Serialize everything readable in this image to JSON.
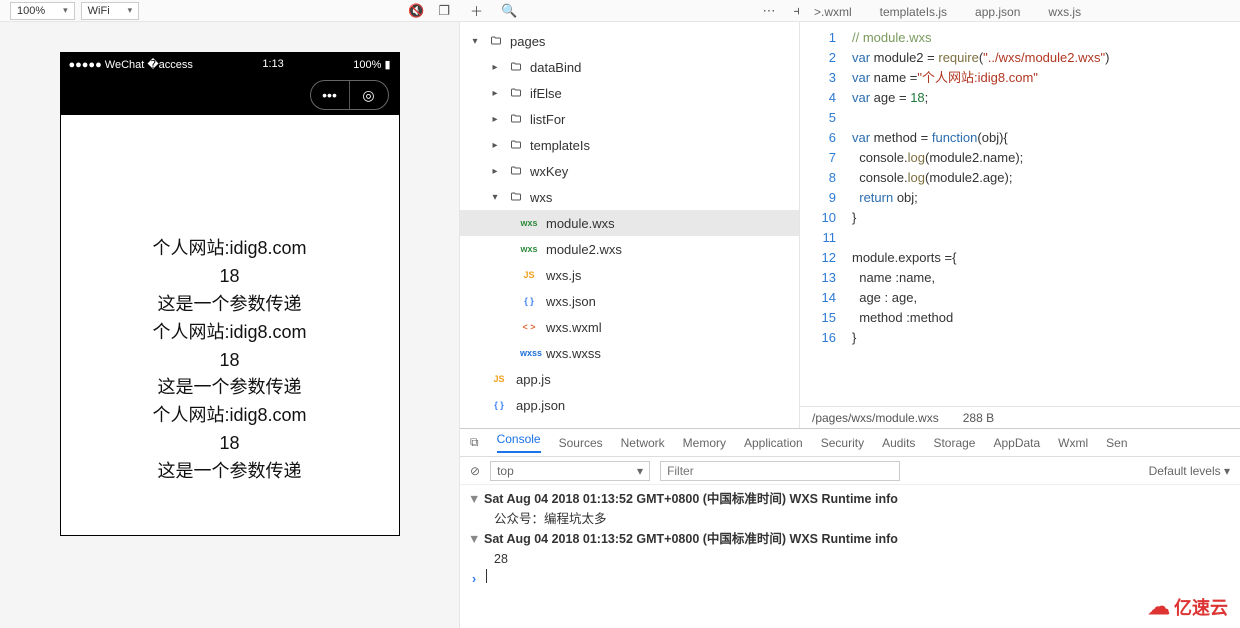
{
  "toolbar": {
    "zoom": "100%",
    "network": "WiFi",
    "tabs": [
      ">.wxml",
      "templateIs.js",
      "app.json",
      "wxs.js"
    ]
  },
  "simulator": {
    "carrier": "WeChat",
    "time": "1:13",
    "battery": "100%",
    "body_lines": [
      "个人网站:idig8.com",
      "18",
      "这是一个参数传递",
      "个人网站:idig8.com",
      "18",
      "这是一个参数传递",
      "个人网站:idig8.com",
      "18",
      "这是一个参数传递"
    ]
  },
  "tree": {
    "root": "pages",
    "folders": [
      "dataBind",
      "ifElse",
      "listFor",
      "templateIs",
      "wxKey"
    ],
    "open_folder": "wxs",
    "files": [
      {
        "icon": "wxs",
        "name": "module.wxs",
        "selected": true
      },
      {
        "icon": "wxs",
        "name": "module2.wxs"
      },
      {
        "icon": "js",
        "name": "wxs.js"
      },
      {
        "icon": "json",
        "name": "wxs.json"
      },
      {
        "icon": "wxml",
        "name": "wxs.wxml"
      },
      {
        "icon": "wxss",
        "name": "wxs.wxss"
      }
    ],
    "root_files": [
      {
        "icon": "js",
        "name": "app.js"
      },
      {
        "icon": "json",
        "name": "app.json"
      }
    ]
  },
  "editor": {
    "status_path": "/pages/wxs/module.wxs",
    "status_size": "288 B",
    "lines": [
      {
        "n": 1,
        "h": "<span class='cm'>// module.wxs</span>"
      },
      {
        "n": 2,
        "h": "<span class='kw'>var</span> module2 = <span class='fn'>require</span>(<span class='str'>\"../wxs/module2.wxs\"</span>)"
      },
      {
        "n": 3,
        "h": "<span class='kw'>var</span> name =<span class='str'>\"个人网站:idig8.com\"</span>"
      },
      {
        "n": 4,
        "h": "<span class='kw'>var</span> age = <span class='num'>18</span>;"
      },
      {
        "n": 5,
        "h": ""
      },
      {
        "n": 6,
        "h": "<span class='kw'>var</span> method = <span class='kw'>function</span>(obj){"
      },
      {
        "n": 7,
        "h": "  console.<span class='fn'>log</span>(module2.name);"
      },
      {
        "n": 8,
        "h": "  console.<span class='fn'>log</span>(module2.age);"
      },
      {
        "n": 9,
        "h": "  <span class='kw'>return</span> obj;"
      },
      {
        "n": 10,
        "h": "}"
      },
      {
        "n": 11,
        "h": ""
      },
      {
        "n": 12,
        "h": "module.exports ={"
      },
      {
        "n": 13,
        "h": "  name :name,"
      },
      {
        "n": 14,
        "h": "  age : age,"
      },
      {
        "n": 15,
        "h": "  method :method"
      },
      {
        "n": 16,
        "h": "}"
      }
    ]
  },
  "devtools": {
    "tabs": [
      "Console",
      "Sources",
      "Network",
      "Memory",
      "Application",
      "Security",
      "Audits",
      "Storage",
      "AppData",
      "Wxml",
      "Sen"
    ],
    "context": "top",
    "filter_placeholder": "Filter",
    "levels": "Default levels",
    "logs": [
      {
        "t": "group",
        "text": "Sat Aug 04 2018 01:13:52 GMT+0800 (中国标准时间) WXS Runtime info"
      },
      {
        "t": "msg",
        "text": "公众号：编程坑太多"
      },
      {
        "t": "group",
        "text": "Sat Aug 04 2018 01:13:52 GMT+0800 (中国标准时间) WXS Runtime info"
      },
      {
        "t": "msg",
        "text": "28"
      }
    ]
  },
  "watermark": "亿速云"
}
